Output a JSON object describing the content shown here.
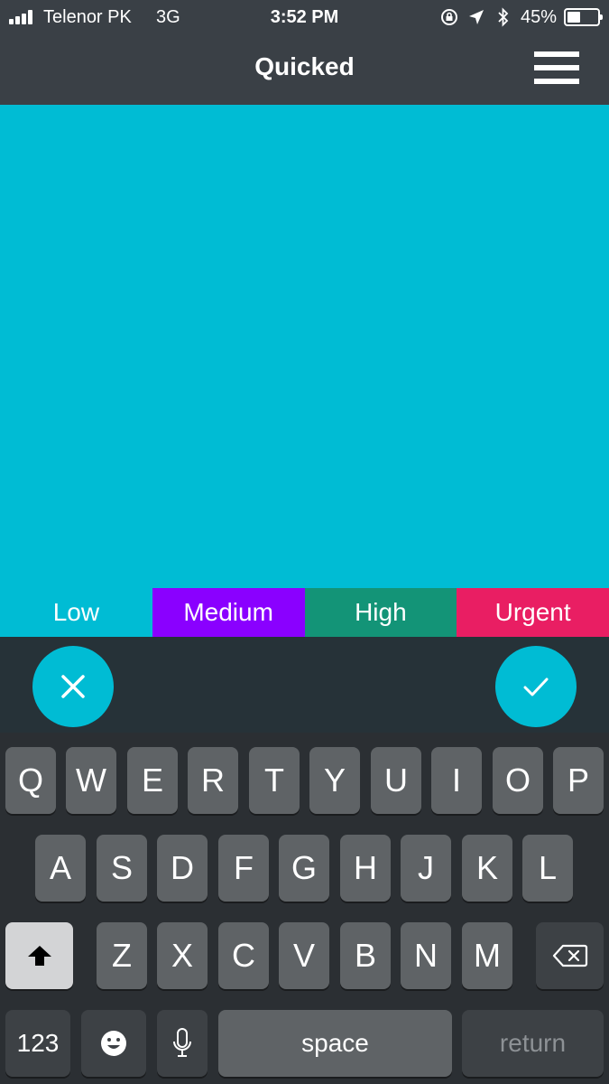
{
  "status_bar": {
    "carrier": "Telenor PK",
    "network": "3G",
    "time": "3:52 PM",
    "battery_percent": "45%",
    "battery_level": 0.45,
    "icons": [
      "signal-icon",
      "orientation-lock-icon",
      "location-icon",
      "bluetooth-icon",
      "battery-icon"
    ]
  },
  "header": {
    "title": "Quicked",
    "menu_icon": "hamburger-menu-icon"
  },
  "content": {
    "background_color": "#00bcd4"
  },
  "priorities": [
    {
      "label": "Low",
      "color": "#00bcd4"
    },
    {
      "label": "Medium",
      "color": "#8a00ff"
    },
    {
      "label": "High",
      "color": "#139477"
    },
    {
      "label": "Urgent",
      "color": "#e91e63"
    }
  ],
  "actions": {
    "cancel_icon": "close-icon",
    "confirm_icon": "check-icon"
  },
  "keyboard": {
    "row1": [
      "Q",
      "W",
      "E",
      "R",
      "T",
      "Y",
      "U",
      "I",
      "O",
      "P"
    ],
    "row2": [
      "A",
      "S",
      "D",
      "F",
      "G",
      "H",
      "J",
      "K",
      "L"
    ],
    "row3": [
      "Z",
      "X",
      "C",
      "V",
      "B",
      "N",
      "M"
    ],
    "numbers_label": "123",
    "space_label": "space",
    "return_label": "return",
    "shift_icon": "shift-icon",
    "backspace_icon": "backspace-icon",
    "emoji_icon": "emoji-icon",
    "mic_icon": "microphone-icon"
  }
}
